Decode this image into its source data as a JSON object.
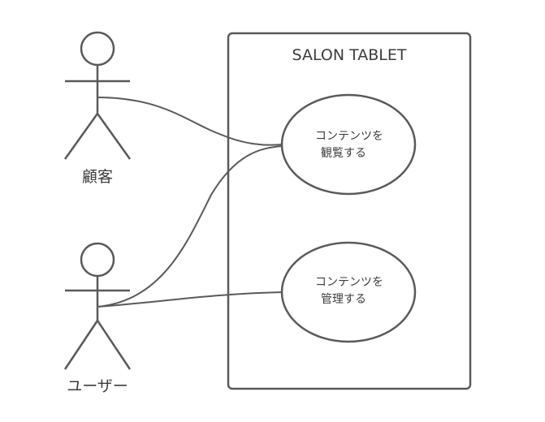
{
  "system": {
    "title": "SALON TABLET"
  },
  "actors": [
    {
      "id": "customer",
      "label": "顧客"
    },
    {
      "id": "user",
      "label": "ユーザー"
    }
  ],
  "use_cases": [
    {
      "id": "view",
      "line1": "コンテンツを",
      "line2": "観覧する"
    },
    {
      "id": "manage",
      "line1": "コンテンツを",
      "line2": "管理する"
    }
  ],
  "associations": [
    {
      "from": "customer",
      "to": "view"
    },
    {
      "from": "user",
      "to": "view"
    },
    {
      "from": "user",
      "to": "manage"
    }
  ],
  "colors": {
    "stroke": "#5a5a5a",
    "text": "#3c3c3c",
    "background": "#ffffff"
  }
}
